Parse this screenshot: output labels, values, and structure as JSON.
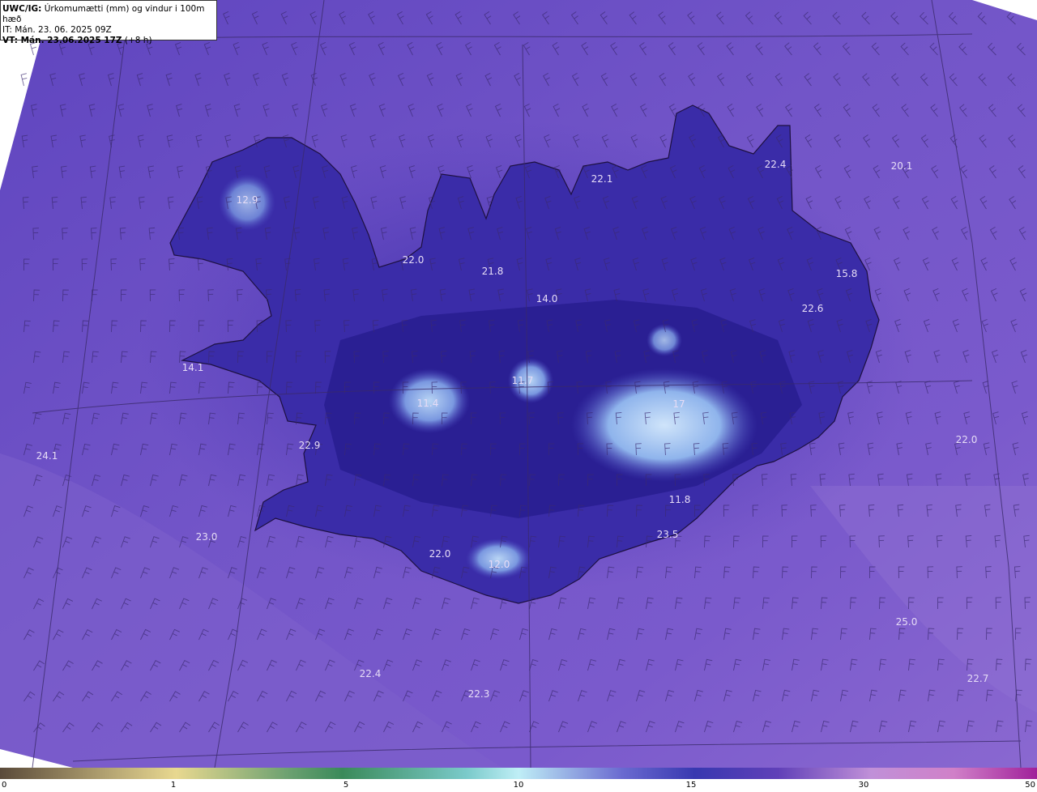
{
  "header": {
    "product_code": "UWC/IG:",
    "title": "Úrkomumætti (mm) og vindur i 100m hæð",
    "init_time": "IT: Mán. 23. 06. 2025 09Z",
    "valid_prefix": "VT: Mán. 23.06.2025 17Z",
    "valid_suffix": "(+8 h)"
  },
  "map_labels": [
    {
      "text": "12.9"
    },
    {
      "text": "22.1"
    },
    {
      "text": "22.4"
    },
    {
      "text": "20.1"
    },
    {
      "text": "22.0"
    },
    {
      "text": "21.8"
    },
    {
      "text": "14.0"
    },
    {
      "text": "15.8"
    },
    {
      "text": "22.6"
    },
    {
      "text": "14.1"
    },
    {
      "text": "11.7"
    },
    {
      "text": "11.4"
    },
    {
      "text": "17"
    },
    {
      "text": "22.9"
    },
    {
      "text": "22.0"
    },
    {
      "text": "24.1"
    },
    {
      "text": "11.8"
    },
    {
      "text": "23.0"
    },
    {
      "text": "23.5"
    },
    {
      "text": "22.0"
    },
    {
      "text": "12.0"
    },
    {
      "text": "25.0"
    },
    {
      "text": "22.4"
    },
    {
      "text": "22.3"
    },
    {
      "text": "22.7"
    }
  ],
  "colorbar": {
    "ticks": [
      "0",
      "1",
      "5",
      "10",
      "15",
      "30",
      "50"
    ],
    "colors": [
      "#5a4a3a",
      "#e8d890",
      "#3a8a5a",
      "#bfeef6",
      "#3838b0",
      "#c090d8",
      "#a0209a"
    ]
  },
  "colors": {
    "sea": "#6c4cc4",
    "land_dark": "#2a1f8a",
    "land_mid": "#3c2ea8",
    "high": "#a8c8f0"
  }
}
